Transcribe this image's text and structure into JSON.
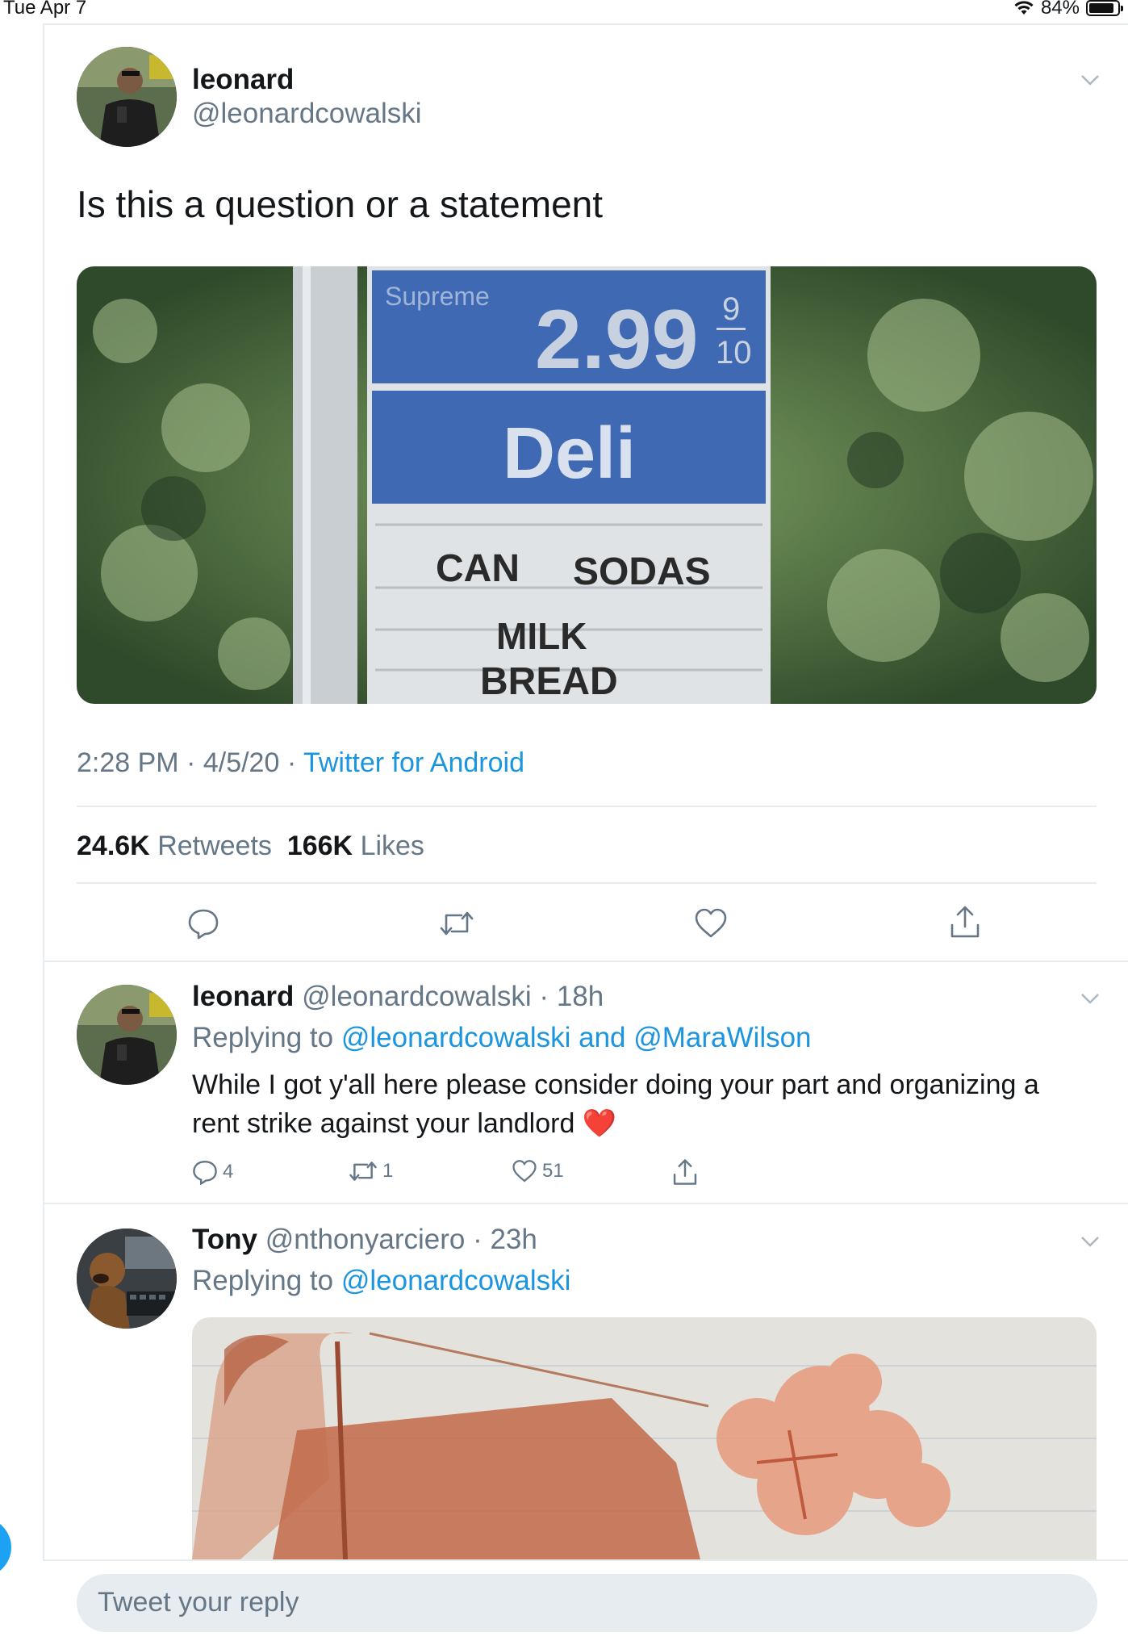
{
  "status": {
    "time": "Tue Apr 7",
    "battery": "84%"
  },
  "main_tweet": {
    "name": "leonard",
    "handle": "@leonardcowalski",
    "text": "Is this a question or a statement",
    "sign": {
      "brand": "Supreme",
      "price": "2.99",
      "frac_top": "9",
      "frac_bottom": "10",
      "deli": "Deli",
      "line1a": "CAN",
      "line1b": "SODAS",
      "line2": "MILK",
      "line3": "BREAD"
    },
    "time": "2:28 PM",
    "date": "4/5/20",
    "source": "Twitter for Android",
    "retweets_count": "24.6K",
    "retweets_label": "Retweets",
    "likes_count": "166K",
    "likes_label": "Likes"
  },
  "replies": [
    {
      "name": "leonard",
      "handle": "@leonardcowalski",
      "age": "18h",
      "replying_prefix": "Replying to",
      "replying_to": "@leonardcowalski and @MaraWilson",
      "text": "While I got y'all here please consider doing your part and organizing a rent strike against your landlord",
      "emoji": "❤️",
      "reply_count": "4",
      "retweet_count": "1",
      "like_count": "51"
    },
    {
      "name": "Tony",
      "handle": "@nthonyarciero",
      "age": "23h",
      "replying_prefix": "Replying to",
      "replying_to": "@leonardcowalski"
    }
  ],
  "composer": {
    "placeholder": "Tweet your reply"
  },
  "colors": {
    "accent": "#1b95e0",
    "muted": "#657786",
    "divider": "#e6ecf0"
  }
}
